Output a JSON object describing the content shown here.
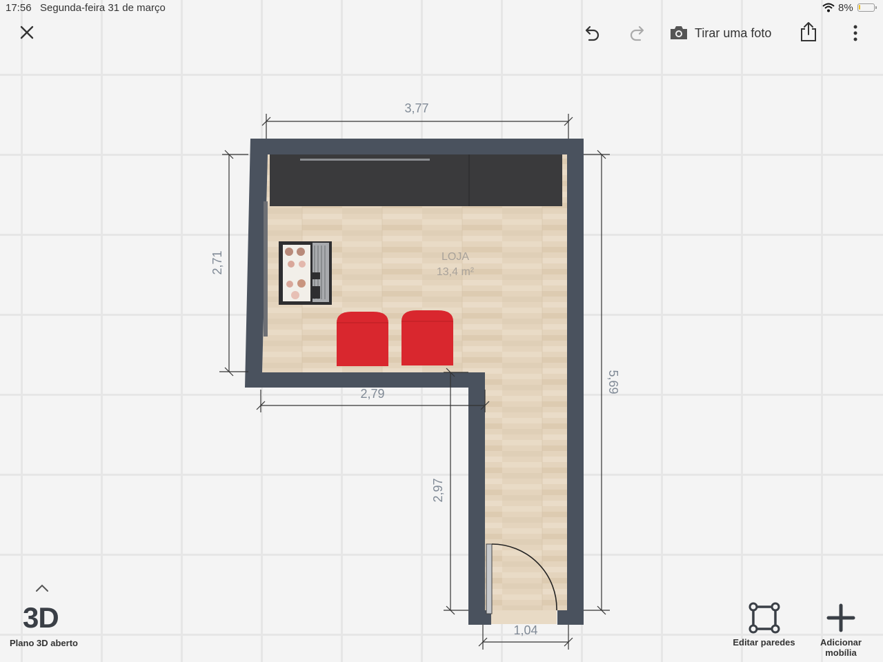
{
  "status_bar": {
    "time": "17:56",
    "date": "Segunda-feira 31 de março",
    "battery": "8%",
    "battery_level_percent": 8
  },
  "toolbar": {
    "close_icon": "close-icon",
    "undo_icon": "undo-icon",
    "redo_icon": "redo-icon",
    "photo_label": "Tirar uma foto",
    "share_icon": "share-icon",
    "more_icon": "more-vertical-icon"
  },
  "plan": {
    "room_name": "LOJA",
    "room_area": "13,4 m²",
    "dimensions": {
      "top_width": "3,77",
      "left_height": "2,71",
      "right_height": "5,69",
      "inner_width": "2,79",
      "corridor_height": "2,97",
      "door_width": "1,04"
    },
    "colors": {
      "wall": "#4a525e",
      "floor": "#e3d3bc",
      "counter": "#3a3a3c",
      "chairs": "#d9272e"
    }
  },
  "bottom": {
    "three_d_label": "3D",
    "three_d_caption": "Plano 3D aberto",
    "edit_walls_label": "Editar paredes",
    "add_furniture_label_1": "Adicionar",
    "add_furniture_label_2": "mobília"
  }
}
